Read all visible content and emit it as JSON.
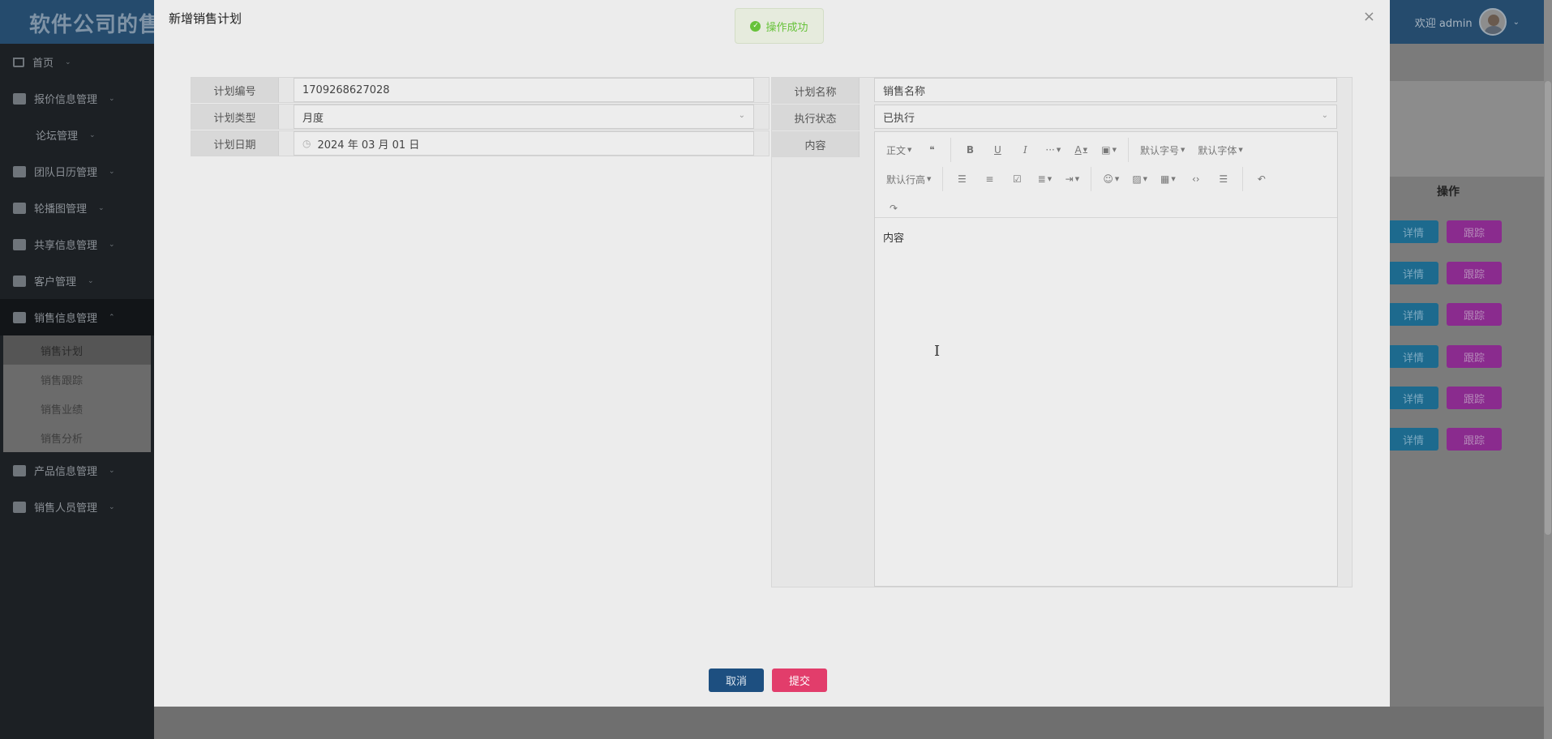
{
  "app": {
    "title": "软件公司的售",
    "welcome": "欢迎 admin"
  },
  "sidebar": {
    "items": [
      {
        "label": "首页"
      },
      {
        "label": "报价信息管理"
      },
      {
        "label": "论坛管理"
      },
      {
        "label": "团队日历管理"
      },
      {
        "label": "轮播图管理"
      },
      {
        "label": "共享信息管理"
      },
      {
        "label": "客户管理"
      },
      {
        "label": "销售信息管理"
      },
      {
        "label": "产品信息管理"
      },
      {
        "label": "销售人员管理"
      }
    ],
    "submenu": [
      {
        "label": "销售计划"
      },
      {
        "label": "销售跟踪"
      },
      {
        "label": "销售业绩"
      },
      {
        "label": "销售分析"
      }
    ]
  },
  "background_table": {
    "column_header": "操作",
    "detail_label": "详情",
    "track_label": "跟踪"
  },
  "modal": {
    "title": "新增销售计划",
    "close": "×",
    "toast": "操作成功",
    "fields": {
      "plan_no": {
        "label": "计划编号",
        "value": "1709268627028"
      },
      "plan_type": {
        "label": "计划类型",
        "value": "月度"
      },
      "plan_date": {
        "label": "计划日期",
        "value": "2024 年 03 月 01 日"
      },
      "plan_name": {
        "label": "计划名称",
        "value": "销售名称"
      },
      "exec_status": {
        "label": "执行状态",
        "value": "已执行"
      },
      "content": {
        "label": "内容",
        "value": "内容"
      }
    },
    "editor_toolbar": {
      "paragraph": "正文",
      "font_size": "默认字号",
      "font_family": "默认字体",
      "line_height": "默认行高"
    },
    "buttons": {
      "cancel": "取消",
      "submit": "提交"
    }
  }
}
